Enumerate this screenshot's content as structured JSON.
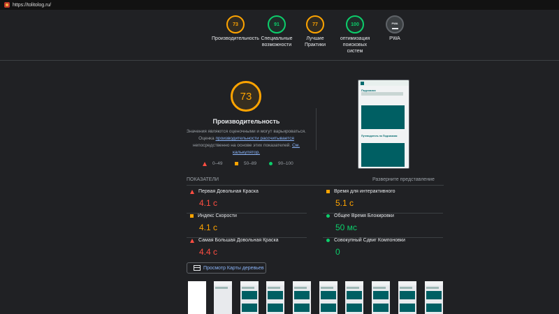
{
  "browser": {
    "url": "https://tolitolog.ru/"
  },
  "header_gauges": [
    {
      "score": "73",
      "label_lines": [
        "Производительность"
      ],
      "status": "orange"
    },
    {
      "score": "91",
      "label_lines": [
        "Специальные",
        "возможности"
      ],
      "status": "green"
    },
    {
      "score": "77",
      "label_lines": [
        "Лучшие",
        "Практики"
      ],
      "status": "orange"
    },
    {
      "score": "100",
      "label_lines": [
        "оптимизация",
        "поисковых",
        "систем"
      ],
      "status": "green"
    },
    {
      "score": "PWA",
      "label_lines": [
        "PWA"
      ],
      "status": "gray"
    }
  ],
  "performance": {
    "score": "73",
    "title": "Производительность",
    "desc_part1": "Значения являются оценочными и могут варьироваться. Оценка ",
    "desc_link": "производительности рассчитывается",
    "desc_part2": " непосредственно на основе этих показателей. ",
    "calc_link": "См. калькулятор."
  },
  "legend": {
    "fail": "0–49",
    "average": "50–89",
    "pass": "90–100"
  },
  "screenshot_preview": {
    "page_title": "Подсказки",
    "section_text": "Путеводитель по Подсказкам"
  },
  "metrics": {
    "section_label": "ПОКАЗАТЕЛИ",
    "expand_label": "Разверните представление",
    "items": [
      {
        "name": "Первая Довольная Краска",
        "value": "4.1 с",
        "status": "red"
      },
      {
        "name": "Время для интерактивного",
        "value": "5.1 с",
        "status": "orange"
      },
      {
        "name": "Индекс Скорости",
        "value": "4.1 с",
        "status": "orange"
      },
      {
        "name": "Общее Время Блокировки",
        "value": "50 мс",
        "status": "green"
      },
      {
        "name": "Самая Большая Довольная Краска",
        "value": "4.4 с",
        "status": "red"
      },
      {
        "name": "Совокупный Сдвиг Компоновки",
        "value": "0",
        "status": "green"
      }
    ]
  },
  "treemap_button": {
    "label": "Просмотр Карты деревьев"
  },
  "colors": {
    "fail": "#ff4e42",
    "average": "#ffa400",
    "pass": "#0cce6b",
    "link": "#8ab4f8",
    "background": "#202124"
  }
}
